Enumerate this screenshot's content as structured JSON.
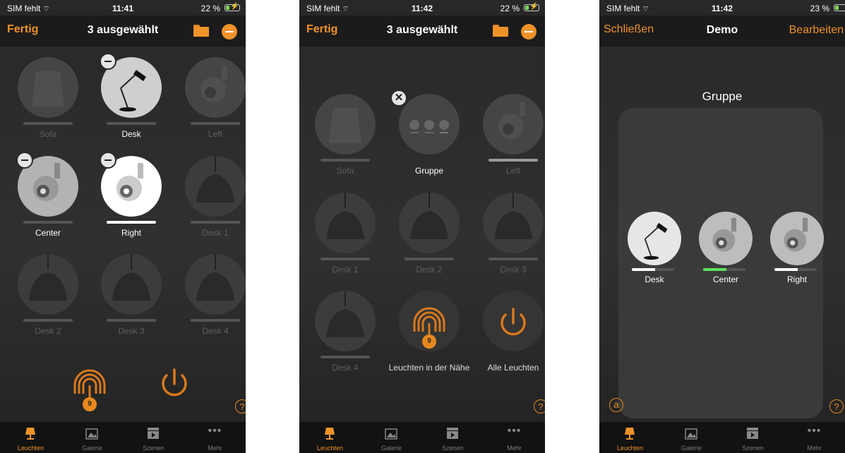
{
  "status": [
    {
      "carrier": "SIM fehlt",
      "time": "11:41",
      "battery": "22 %"
    },
    {
      "carrier": "SIM fehlt",
      "time": "11:42",
      "battery": "22 %"
    },
    {
      "carrier": "SIM fehlt",
      "time": "11:42",
      "battery": "23 %"
    }
  ],
  "screen1": {
    "nav": {
      "left": "Fertig",
      "title": "3 ausgewählt"
    },
    "lights": [
      {
        "label": "Sofa"
      },
      {
        "label": "Desk"
      },
      {
        "label": "Left"
      },
      {
        "label": "Center"
      },
      {
        "label": "Right"
      },
      {
        "label": "Desk 1"
      },
      {
        "label": "Desk 2"
      },
      {
        "label": "Desk 3"
      },
      {
        "label": "Desk 4"
      }
    ],
    "nearby_count": "9",
    "help": "?"
  },
  "screen2": {
    "nav": {
      "left": "Fertig",
      "title": "3 ausgewählt"
    },
    "lights": [
      {
        "label": "Sofa"
      },
      {
        "label": "Gruppe"
      },
      {
        "label": "Left"
      },
      {
        "label": "Desk 1"
      },
      {
        "label": "Desk 2"
      },
      {
        "label": "Desk 3"
      },
      {
        "label": "Desk 4"
      },
      {
        "label": "Leuchten in der Nähe"
      },
      {
        "label": "Alle Leuchten"
      }
    ],
    "close": "✕",
    "nearby_count": "9",
    "help": "?"
  },
  "screen3": {
    "nav": {
      "left": "Schließen",
      "title": "Demo",
      "right": "Bearbeiten"
    },
    "group_title": "Gruppe",
    "members": [
      {
        "label": "Desk",
        "level": 0.55,
        "color": "#ffffff"
      },
      {
        "label": "Center",
        "level": 0.55,
        "color": "#5fe05f"
      },
      {
        "label": "Right",
        "level": 0.55,
        "color": "#ffffff"
      }
    ],
    "auto_icon": "a",
    "help": "?"
  },
  "tabbar": [
    "Leuchten",
    "Galerie",
    "Szenen",
    "Mehr"
  ],
  "more_dots": "•••",
  "colors": {
    "accent": "#f0922a",
    "navbar": "#1b1b1b",
    "tabbar": "#121212"
  },
  "icons": [
    "wifi-icon",
    "battery-icon",
    "folder-icon",
    "minus-circle-icon",
    "close-icon",
    "lamp-icon",
    "gallery-icon",
    "scenes-icon",
    "more-icon",
    "help-icon",
    "auto-icon",
    "nearby-icon",
    "power-icon"
  ]
}
